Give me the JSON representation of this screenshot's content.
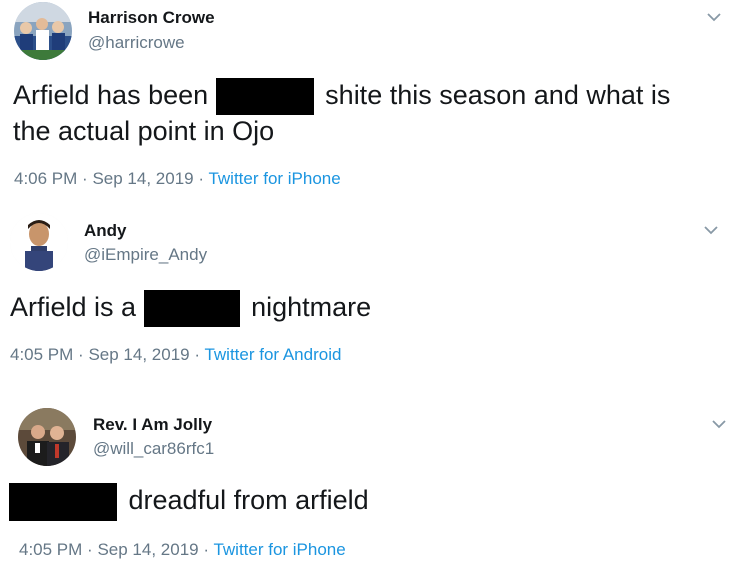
{
  "tweets": [
    {
      "name": "Harrison Crowe",
      "handle": "@harricrowe",
      "text_before": "Arfield has been",
      "text_after_line1": "shite this season and what is",
      "text_line2": "the actual point in Ojo",
      "time": "4:06 PM",
      "separator": "·",
      "date": "Sep 14, 2019",
      "source": "Twitter for iPhone",
      "icons": {
        "menu": "chevron-down-icon"
      }
    },
    {
      "name": "Andy",
      "handle": "@iEmpire_Andy",
      "text_before": "Arfield is a",
      "text_after": "nightmare",
      "time": "4:05 PM",
      "separator": "·",
      "date": "Sep 14, 2019",
      "source": "Twitter for Android",
      "icons": {
        "menu": "chevron-down-icon"
      }
    },
    {
      "name": "Rev. I Am Jolly",
      "handle": "@will_car86rfc1",
      "text_after": "dreadful from arfield",
      "time": "4:05 PM",
      "separator": "·",
      "date": "Sep 14, 2019",
      "source": "Twitter for iPhone",
      "icons": {
        "menu": "chevron-down-icon"
      }
    }
  ],
  "colors": {
    "text": "#14171a",
    "secondary": "#657786",
    "link": "#1b95e0",
    "redaction": "#000000"
  }
}
